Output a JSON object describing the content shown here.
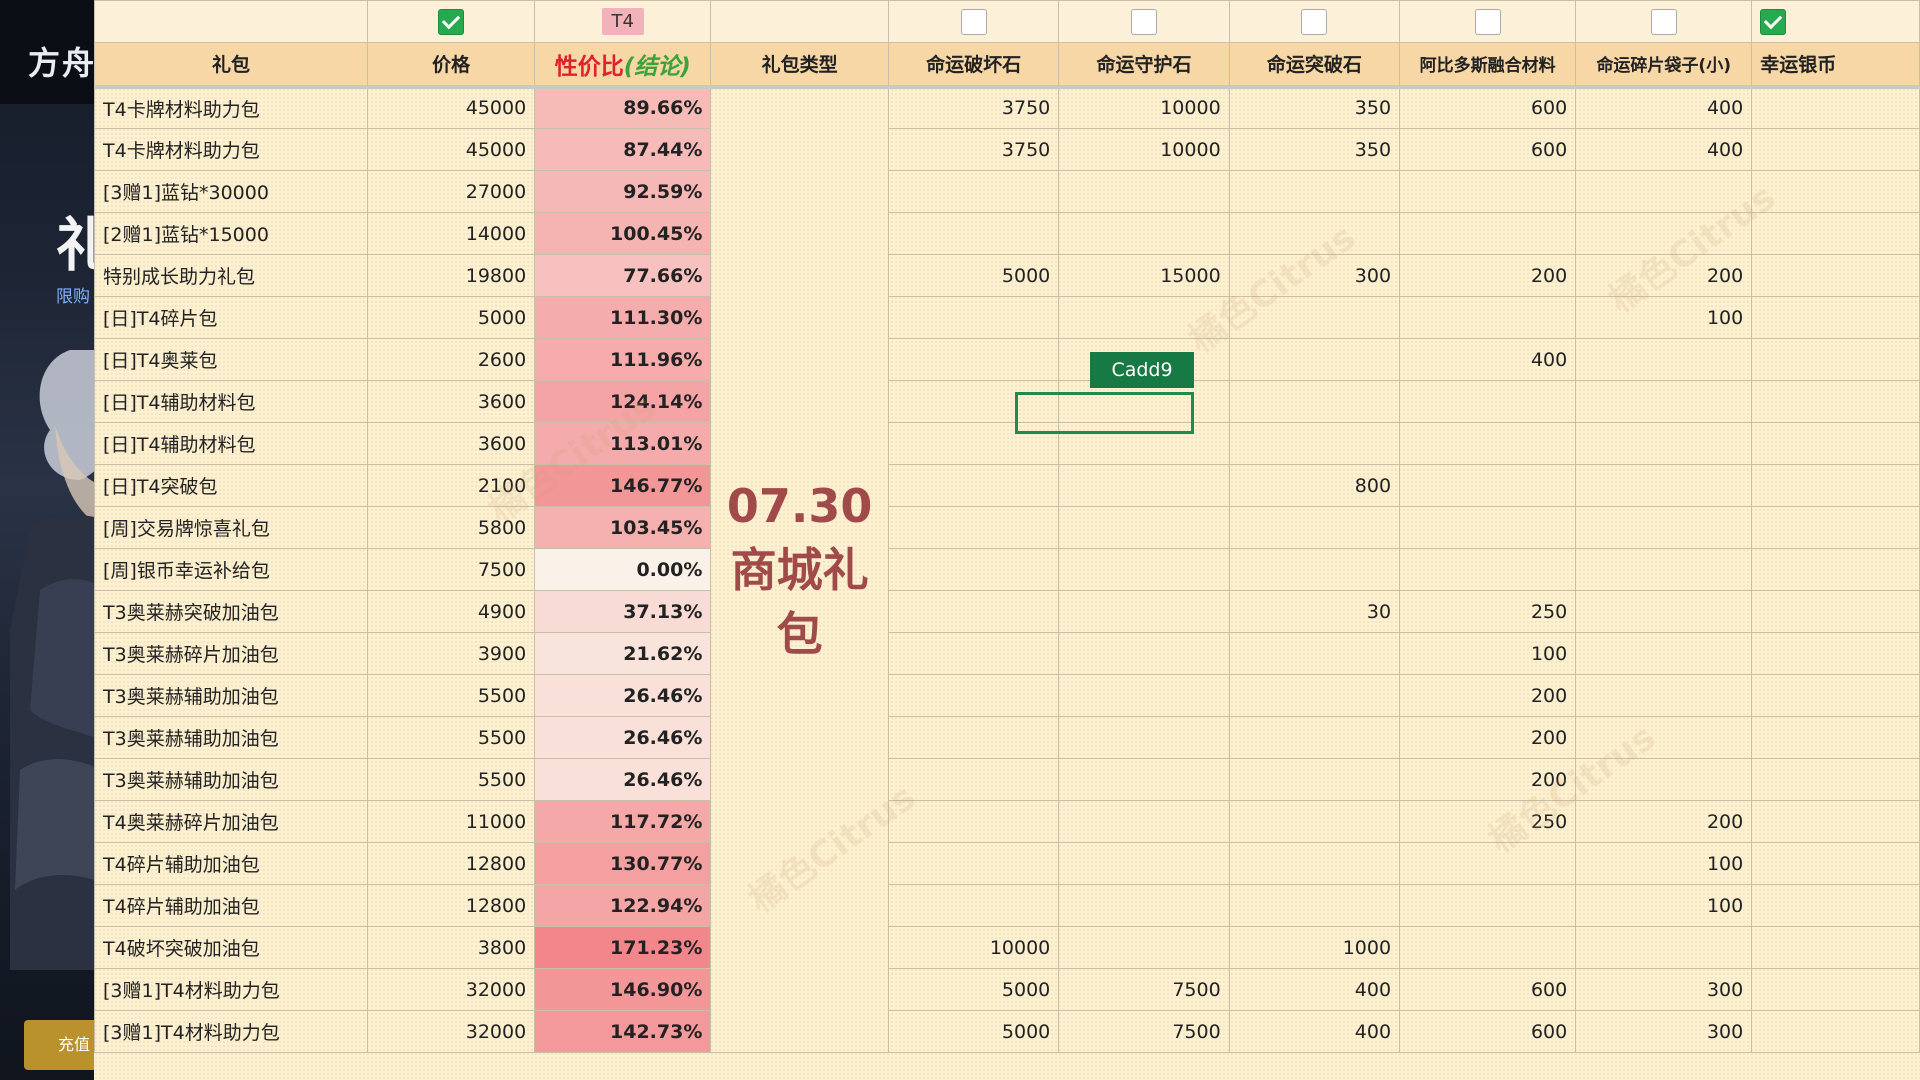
{
  "background_app": {
    "title": "方舟",
    "big_char": "礼",
    "subtitle": "限购",
    "recharge_button": "充值"
  },
  "watermark": "橘色Citrus",
  "toolbar": {
    "t4_tag": "T4"
  },
  "columns": {
    "gift": "礼包",
    "price": "价格",
    "ratio_red": "性价比",
    "ratio_green": "(结论)",
    "type": "礼包类型",
    "c1": "命运破坏石",
    "c2": "命运守护石",
    "c3": "命运突破石",
    "c4": "阿比多斯融合材料",
    "c5": "命运碎片袋子(小)",
    "c6": "幸运银币"
  },
  "gift_type_label": "07.30商城礼包",
  "cadd9_label": "Cadd9",
  "rows": [
    {
      "name": "T4卡牌材料助力包",
      "price": "45000",
      "ratio": "89.66%",
      "c1": "3750",
      "c2": "10000",
      "c3": "350",
      "c4": "600",
      "c5": "400"
    },
    {
      "name": "T4卡牌材料助力包",
      "price": "45000",
      "ratio": "87.44%",
      "c1": "3750",
      "c2": "10000",
      "c3": "350",
      "c4": "600",
      "c5": "400"
    },
    {
      "name": "[3赠1]蓝钻*30000",
      "price": "27000",
      "ratio": "92.59%",
      "c1": "",
      "c2": "",
      "c3": "",
      "c4": "",
      "c5": ""
    },
    {
      "name": "[2赠1]蓝钻*15000",
      "price": "14000",
      "ratio": "100.45%",
      "c1": "",
      "c2": "",
      "c3": "",
      "c4": "",
      "c5": ""
    },
    {
      "name": "特别成长助力礼包",
      "price": "19800",
      "ratio": "77.66%",
      "c1": "5000",
      "c2": "15000",
      "c3": "300",
      "c4": "200",
      "c5": "200"
    },
    {
      "name": "[日]T4碎片包",
      "price": "5000",
      "ratio": "111.30%",
      "c1": "",
      "c2": "",
      "c3": "",
      "c4": "",
      "c5": "100"
    },
    {
      "name": "[日]T4奥莱包",
      "price": "2600",
      "ratio": "111.96%",
      "c1": "",
      "c2": "",
      "c3": "",
      "c4": "400",
      "c5": ""
    },
    {
      "name": "[日]T4辅助材料包",
      "price": "3600",
      "ratio": "124.14%",
      "c1": "",
      "c2": "",
      "c3": "",
      "c4": "",
      "c5": ""
    },
    {
      "name": "[日]T4辅助材料包",
      "price": "3600",
      "ratio": "113.01%",
      "c1": "",
      "c2": "",
      "c3": "",
      "c4": "",
      "c5": ""
    },
    {
      "name": "[日]T4突破包",
      "price": "2100",
      "ratio": "146.77%",
      "c1": "",
      "c2": "",
      "c3": "800",
      "c4": "",
      "c5": ""
    },
    {
      "name": "[周]交易牌惊喜礼包",
      "price": "5800",
      "ratio": "103.45%",
      "c1": "",
      "c2": "",
      "c3": "",
      "c4": "",
      "c5": ""
    },
    {
      "name": "[周]银币幸运补给包",
      "price": "7500",
      "ratio": "0.00%",
      "c1": "",
      "c2": "",
      "c3": "",
      "c4": "",
      "c5": ""
    },
    {
      "name": "T3奥莱赫突破加油包",
      "price": "4900",
      "ratio": "37.13%",
      "c1": "",
      "c2": "",
      "c3": "30",
      "c4": "250",
      "c5": ""
    },
    {
      "name": "T3奥莱赫碎片加油包",
      "price": "3900",
      "ratio": "21.62%",
      "c1": "",
      "c2": "",
      "c3": "",
      "c4": "100",
      "c5": ""
    },
    {
      "name": "T3奥莱赫辅助加油包",
      "price": "5500",
      "ratio": "26.46%",
      "c1": "",
      "c2": "",
      "c3": "",
      "c4": "200",
      "c5": ""
    },
    {
      "name": "T3奥莱赫辅助加油包",
      "price": "5500",
      "ratio": "26.46%",
      "c1": "",
      "c2": "",
      "c3": "",
      "c4": "200",
      "c5": ""
    },
    {
      "name": "T3奥莱赫辅助加油包",
      "price": "5500",
      "ratio": "26.46%",
      "c1": "",
      "c2": "",
      "c3": "",
      "c4": "200",
      "c5": ""
    },
    {
      "name": "T4奥莱赫碎片加油包",
      "price": "11000",
      "ratio": "117.72%",
      "c1": "",
      "c2": "",
      "c3": "",
      "c4": "250",
      "c5": "200"
    },
    {
      "name": "T4碎片辅助加油包",
      "price": "12800",
      "ratio": "130.77%",
      "c1": "",
      "c2": "",
      "c3": "",
      "c4": "",
      "c5": "100"
    },
    {
      "name": "T4碎片辅助加油包",
      "price": "12800",
      "ratio": "122.94%",
      "c1": "",
      "c2": "",
      "c3": "",
      "c4": "",
      "c5": "100"
    },
    {
      "name": "T4破坏突破加油包",
      "price": "3800",
      "ratio": "171.23%",
      "c1": "10000",
      "c2": "",
      "c3": "1000",
      "c4": "",
      "c5": ""
    },
    {
      "name": "[3赠1]T4材料助力包",
      "price": "32000",
      "ratio": "146.90%",
      "c1": "5000",
      "c2": "7500",
      "c3": "400",
      "c4": "600",
      "c5": "300"
    },
    {
      "name": "[3赠1]T4材料助力包",
      "price": "32000",
      "ratio": "142.73%",
      "c1": "5000",
      "c2": "7500",
      "c3": "400",
      "c4": "600",
      "c5": "300"
    }
  ],
  "colors": {
    "sheet_bg": "#fdf1d2",
    "header_bg": "#f6d7a5",
    "ratio_red": "#e0202e",
    "ratio_green": "#3ba33a",
    "blue_price": "#2a5bd7",
    "selection_green": "#1f8b4c"
  },
  "icons": {
    "checked": "checkbox-checked-icon",
    "unchecked": "checkbox-unchecked-icon"
  }
}
